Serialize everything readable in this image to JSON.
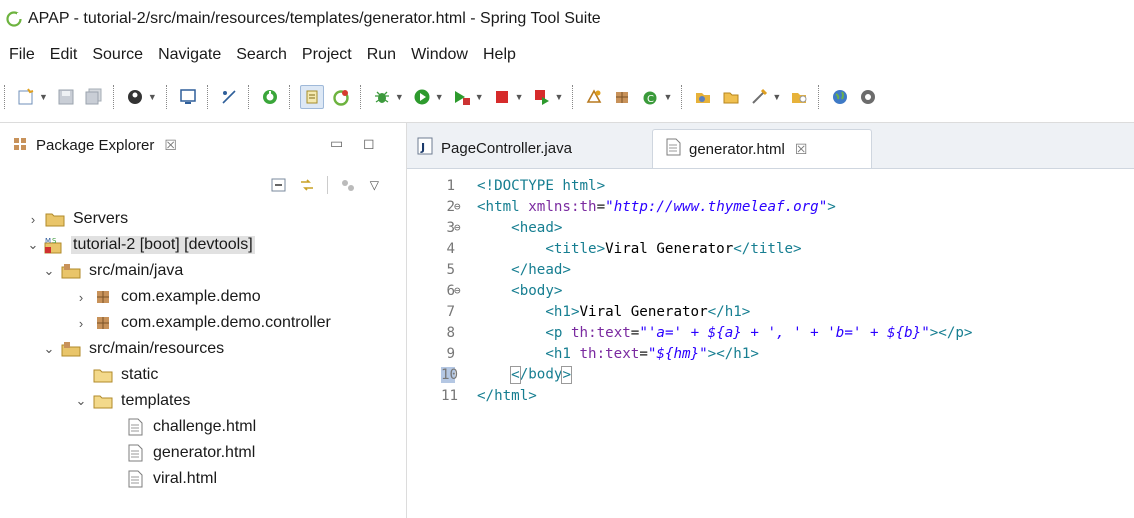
{
  "window": {
    "title": "APAP - tutorial-2/src/main/resources/templates/generator.html - Spring Tool Suite"
  },
  "menu": [
    "File",
    "Edit",
    "Source",
    "Navigate",
    "Search",
    "Project",
    "Run",
    "Window",
    "Help"
  ],
  "package_explorer": {
    "tab_title": "Package Explorer",
    "tree": [
      {
        "label": "Servers",
        "expanded": false,
        "icon": "folder-icon"
      },
      {
        "label": "tutorial-2 [boot] [devtools]",
        "expanded": true,
        "icon": "spring-project-icon",
        "selected": true
      },
      {
        "label": "src/main/java",
        "expanded": true,
        "icon": "source-folder-icon"
      },
      {
        "label": "com.example.demo",
        "expanded": false,
        "icon": "package-icon"
      },
      {
        "label": "com.example.demo.controller",
        "expanded": false,
        "icon": "package-icon"
      },
      {
        "label": "src/main/resources",
        "expanded": true,
        "icon": "source-folder-icon"
      },
      {
        "label": "static",
        "icon": "folder-icon"
      },
      {
        "label": "templates",
        "expanded": true,
        "icon": "folder-icon"
      },
      {
        "label": "challenge.html",
        "icon": "html-file-icon"
      },
      {
        "label": "generator.html",
        "icon": "html-file-icon"
      },
      {
        "label": "viral.html",
        "icon": "html-file-icon"
      }
    ]
  },
  "editor": {
    "tabs": [
      {
        "label": "PageController.java",
        "active": false,
        "icon": "java-file-icon"
      },
      {
        "label": "generator.html",
        "active": true,
        "icon": "html-file-icon"
      }
    ],
    "lines": [
      {
        "no": "1",
        "text": "<!DOCTYPE html>"
      },
      {
        "no": "2",
        "text": "<html xmlns:th=\"http://www.thymeleaf.org\">"
      },
      {
        "no": "3",
        "text": "    <head>"
      },
      {
        "no": "4",
        "text": "        <title>Viral Generator</title>"
      },
      {
        "no": "5",
        "text": "    </head>"
      },
      {
        "no": "6",
        "text": "    <body>"
      },
      {
        "no": "7",
        "text": "        <h1>Viral Generator</h1>"
      },
      {
        "no": "8",
        "text": "        <p th:text=\"'a=' + ${a} + ', ' + 'b=' + ${b}\"></p>"
      },
      {
        "no": "9",
        "text": "        <h1 th:text=\"${hm}\"></h1>"
      },
      {
        "no": "10",
        "text": "    </body>"
      },
      {
        "no": "11",
        "text": "</html>"
      }
    ],
    "current_line": 10
  },
  "colors": {
    "tag": "#167e91",
    "attribute": "#7a2aa0",
    "string": "#2a00ff",
    "selection": "#e1e1e1"
  }
}
